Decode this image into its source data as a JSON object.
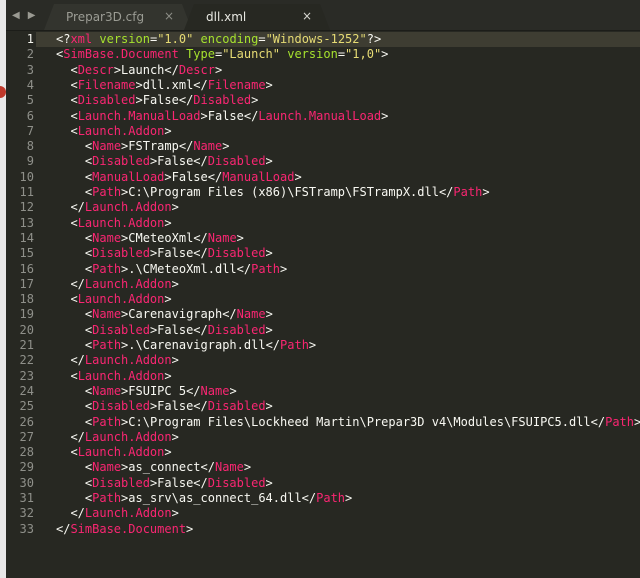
{
  "tabs": [
    {
      "label": "Prepar3D.cfg",
      "active": false,
      "close": "×"
    },
    {
      "label": "dll.xml",
      "active": true,
      "close": "×"
    }
  ],
  "nav": {
    "left": "◀",
    "right": "▶"
  },
  "current_line": 1,
  "colors": {
    "background": "#272822",
    "tag": "#f92672",
    "attribute": "#a6e22e",
    "string": "#e6db74",
    "text": "#f8f8f2",
    "line_number": "#8f908a"
  },
  "lines": [
    {
      "num": "1",
      "tokens": [
        {
          "t": "br",
          "v": "<?"
        },
        {
          "t": "kw",
          "v": "xml"
        },
        {
          "t": "txt",
          "v": " "
        },
        {
          "t": "attr",
          "v": "version"
        },
        {
          "t": "br",
          "v": "="
        },
        {
          "t": "str",
          "v": "\"1.0\""
        },
        {
          "t": "txt",
          "v": " "
        },
        {
          "t": "attr",
          "v": "encoding"
        },
        {
          "t": "br",
          "v": "="
        },
        {
          "t": "str",
          "v": "\"Windows-1252\""
        },
        {
          "t": "br",
          "v": "?>"
        }
      ]
    },
    {
      "num": "2",
      "tokens": [
        {
          "t": "br",
          "v": "<"
        },
        {
          "t": "tag",
          "v": "SimBase.Document"
        },
        {
          "t": "txt",
          "v": " "
        },
        {
          "t": "attr",
          "v": "Type"
        },
        {
          "t": "br",
          "v": "="
        },
        {
          "t": "str",
          "v": "\"Launch\""
        },
        {
          "t": "txt",
          "v": " "
        },
        {
          "t": "attr",
          "v": "version"
        },
        {
          "t": "br",
          "v": "="
        },
        {
          "t": "str",
          "v": "\"1,0\""
        },
        {
          "t": "br",
          "v": ">"
        }
      ]
    },
    {
      "num": "3",
      "tokens": [
        {
          "t": "txt",
          "v": "  "
        },
        {
          "t": "br",
          "v": "<"
        },
        {
          "t": "tag",
          "v": "Descr"
        },
        {
          "t": "br",
          "v": ">"
        },
        {
          "t": "txt",
          "v": "Launch"
        },
        {
          "t": "br",
          "v": "</"
        },
        {
          "t": "tag",
          "v": "Descr"
        },
        {
          "t": "br",
          "v": ">"
        }
      ]
    },
    {
      "num": "4",
      "tokens": [
        {
          "t": "txt",
          "v": "  "
        },
        {
          "t": "br",
          "v": "<"
        },
        {
          "t": "tag",
          "v": "Filename"
        },
        {
          "t": "br",
          "v": ">"
        },
        {
          "t": "txt",
          "v": "dll.xml"
        },
        {
          "t": "br",
          "v": "</"
        },
        {
          "t": "tag",
          "v": "Filename"
        },
        {
          "t": "br",
          "v": ">"
        }
      ]
    },
    {
      "num": "5",
      "tokens": [
        {
          "t": "txt",
          "v": "  "
        },
        {
          "t": "br",
          "v": "<"
        },
        {
          "t": "tag",
          "v": "Disabled"
        },
        {
          "t": "br",
          "v": ">"
        },
        {
          "t": "txt",
          "v": "False"
        },
        {
          "t": "br",
          "v": "</"
        },
        {
          "t": "tag",
          "v": "Disabled"
        },
        {
          "t": "br",
          "v": ">"
        }
      ]
    },
    {
      "num": "6",
      "tokens": [
        {
          "t": "txt",
          "v": "  "
        },
        {
          "t": "br",
          "v": "<"
        },
        {
          "t": "tag",
          "v": "Launch.ManualLoad"
        },
        {
          "t": "br",
          "v": ">"
        },
        {
          "t": "txt",
          "v": "False"
        },
        {
          "t": "br",
          "v": "</"
        },
        {
          "t": "tag",
          "v": "Launch.ManualLoad"
        },
        {
          "t": "br",
          "v": ">"
        }
      ]
    },
    {
      "num": "7",
      "tokens": [
        {
          "t": "txt",
          "v": "  "
        },
        {
          "t": "br",
          "v": "<"
        },
        {
          "t": "tag",
          "v": "Launch.Addon"
        },
        {
          "t": "br",
          "v": ">"
        }
      ]
    },
    {
      "num": "8",
      "tokens": [
        {
          "t": "txt",
          "v": "    "
        },
        {
          "t": "br",
          "v": "<"
        },
        {
          "t": "tag",
          "v": "Name"
        },
        {
          "t": "br",
          "v": ">"
        },
        {
          "t": "txt",
          "v": "FSTramp"
        },
        {
          "t": "br",
          "v": "</"
        },
        {
          "t": "tag",
          "v": "Name"
        },
        {
          "t": "br",
          "v": ">"
        }
      ]
    },
    {
      "num": "9",
      "tokens": [
        {
          "t": "txt",
          "v": "    "
        },
        {
          "t": "br",
          "v": "<"
        },
        {
          "t": "tag",
          "v": "Disabled"
        },
        {
          "t": "br",
          "v": ">"
        },
        {
          "t": "txt",
          "v": "False"
        },
        {
          "t": "br",
          "v": "</"
        },
        {
          "t": "tag",
          "v": "Disabled"
        },
        {
          "t": "br",
          "v": ">"
        }
      ]
    },
    {
      "num": "10",
      "tokens": [
        {
          "t": "txt",
          "v": "    "
        },
        {
          "t": "br",
          "v": "<"
        },
        {
          "t": "tag",
          "v": "ManualLoad"
        },
        {
          "t": "br",
          "v": ">"
        },
        {
          "t": "txt",
          "v": "False"
        },
        {
          "t": "br",
          "v": "</"
        },
        {
          "t": "tag",
          "v": "ManualLoad"
        },
        {
          "t": "br",
          "v": ">"
        }
      ]
    },
    {
      "num": "11",
      "tokens": [
        {
          "t": "txt",
          "v": "    "
        },
        {
          "t": "br",
          "v": "<"
        },
        {
          "t": "tag",
          "v": "Path"
        },
        {
          "t": "br",
          "v": ">"
        },
        {
          "t": "txt",
          "v": "C:\\Program Files (x86)\\FSTramp\\FSTrampX.dll"
        },
        {
          "t": "br",
          "v": "</"
        },
        {
          "t": "tag",
          "v": "Path"
        },
        {
          "t": "br",
          "v": ">"
        }
      ]
    },
    {
      "num": "12",
      "tokens": [
        {
          "t": "txt",
          "v": "  "
        },
        {
          "t": "br",
          "v": "</"
        },
        {
          "t": "tag",
          "v": "Launch.Addon"
        },
        {
          "t": "br",
          "v": ">"
        }
      ]
    },
    {
      "num": "13",
      "tokens": [
        {
          "t": "txt",
          "v": "  "
        },
        {
          "t": "br",
          "v": "<"
        },
        {
          "t": "tag",
          "v": "Launch.Addon"
        },
        {
          "t": "br",
          "v": ">"
        }
      ]
    },
    {
      "num": "14",
      "tokens": [
        {
          "t": "txt",
          "v": "    "
        },
        {
          "t": "br",
          "v": "<"
        },
        {
          "t": "tag",
          "v": "Name"
        },
        {
          "t": "br",
          "v": ">"
        },
        {
          "t": "txt",
          "v": "CMeteoXml"
        },
        {
          "t": "br",
          "v": "</"
        },
        {
          "t": "tag",
          "v": "Name"
        },
        {
          "t": "br",
          "v": ">"
        }
      ]
    },
    {
      "num": "15",
      "tokens": [
        {
          "t": "txt",
          "v": "    "
        },
        {
          "t": "br",
          "v": "<"
        },
        {
          "t": "tag",
          "v": "Disabled"
        },
        {
          "t": "br",
          "v": ">"
        },
        {
          "t": "txt",
          "v": "False"
        },
        {
          "t": "br",
          "v": "</"
        },
        {
          "t": "tag",
          "v": "Disabled"
        },
        {
          "t": "br",
          "v": ">"
        }
      ]
    },
    {
      "num": "16",
      "tokens": [
        {
          "t": "txt",
          "v": "    "
        },
        {
          "t": "br",
          "v": "<"
        },
        {
          "t": "tag",
          "v": "Path"
        },
        {
          "t": "br",
          "v": ">"
        },
        {
          "t": "txt",
          "v": ".\\CMeteoXml.dll"
        },
        {
          "t": "br",
          "v": "</"
        },
        {
          "t": "tag",
          "v": "Path"
        },
        {
          "t": "br",
          "v": ">"
        }
      ]
    },
    {
      "num": "17",
      "tokens": [
        {
          "t": "txt",
          "v": "  "
        },
        {
          "t": "br",
          "v": "</"
        },
        {
          "t": "tag",
          "v": "Launch.Addon"
        },
        {
          "t": "br",
          "v": ">"
        }
      ]
    },
    {
      "num": "18",
      "tokens": [
        {
          "t": "txt",
          "v": "  "
        },
        {
          "t": "br",
          "v": "<"
        },
        {
          "t": "tag",
          "v": "Launch.Addon"
        },
        {
          "t": "br",
          "v": ">"
        }
      ]
    },
    {
      "num": "19",
      "tokens": [
        {
          "t": "txt",
          "v": "    "
        },
        {
          "t": "br",
          "v": "<"
        },
        {
          "t": "tag",
          "v": "Name"
        },
        {
          "t": "br",
          "v": ">"
        },
        {
          "t": "txt",
          "v": "Carenavigraph"
        },
        {
          "t": "br",
          "v": "</"
        },
        {
          "t": "tag",
          "v": "Name"
        },
        {
          "t": "br",
          "v": ">"
        }
      ]
    },
    {
      "num": "20",
      "tokens": [
        {
          "t": "txt",
          "v": "    "
        },
        {
          "t": "br",
          "v": "<"
        },
        {
          "t": "tag",
          "v": "Disabled"
        },
        {
          "t": "br",
          "v": ">"
        },
        {
          "t": "txt",
          "v": "False"
        },
        {
          "t": "br",
          "v": "</"
        },
        {
          "t": "tag",
          "v": "Disabled"
        },
        {
          "t": "br",
          "v": ">"
        }
      ]
    },
    {
      "num": "21",
      "tokens": [
        {
          "t": "txt",
          "v": "    "
        },
        {
          "t": "br",
          "v": "<"
        },
        {
          "t": "tag",
          "v": "Path"
        },
        {
          "t": "br",
          "v": ">"
        },
        {
          "t": "txt",
          "v": ".\\Carenavigraph.dll"
        },
        {
          "t": "br",
          "v": "</"
        },
        {
          "t": "tag",
          "v": "Path"
        },
        {
          "t": "br",
          "v": ">"
        }
      ]
    },
    {
      "num": "22",
      "tokens": [
        {
          "t": "txt",
          "v": "  "
        },
        {
          "t": "br",
          "v": "</"
        },
        {
          "t": "tag",
          "v": "Launch.Addon"
        },
        {
          "t": "br",
          "v": ">"
        }
      ]
    },
    {
      "num": "23",
      "tokens": [
        {
          "t": "txt",
          "v": "  "
        },
        {
          "t": "br",
          "v": "<"
        },
        {
          "t": "tag",
          "v": "Launch.Addon"
        },
        {
          "t": "br",
          "v": ">"
        }
      ]
    },
    {
      "num": "24",
      "tokens": [
        {
          "t": "txt",
          "v": "    "
        },
        {
          "t": "br",
          "v": "<"
        },
        {
          "t": "tag",
          "v": "Name"
        },
        {
          "t": "br",
          "v": ">"
        },
        {
          "t": "txt",
          "v": "FSUIPC 5"
        },
        {
          "t": "br",
          "v": "</"
        },
        {
          "t": "tag",
          "v": "Name"
        },
        {
          "t": "br",
          "v": ">"
        }
      ]
    },
    {
      "num": "25",
      "tokens": [
        {
          "t": "txt",
          "v": "    "
        },
        {
          "t": "br",
          "v": "<"
        },
        {
          "t": "tag",
          "v": "Disabled"
        },
        {
          "t": "br",
          "v": ">"
        },
        {
          "t": "txt",
          "v": "False"
        },
        {
          "t": "br",
          "v": "</"
        },
        {
          "t": "tag",
          "v": "Disabled"
        },
        {
          "t": "br",
          "v": ">"
        }
      ]
    },
    {
      "num": "26",
      "tokens": [
        {
          "t": "txt",
          "v": "    "
        },
        {
          "t": "br",
          "v": "<"
        },
        {
          "t": "tag",
          "v": "Path"
        },
        {
          "t": "br",
          "v": ">"
        },
        {
          "t": "txt",
          "v": "C:\\Program Files\\Lockheed Martin\\Prepar3D v4\\Modules\\FSUIPC5.dll"
        },
        {
          "t": "br",
          "v": "</"
        },
        {
          "t": "tag",
          "v": "Path"
        },
        {
          "t": "br",
          "v": ">"
        }
      ]
    },
    {
      "num": "27",
      "tokens": [
        {
          "t": "txt",
          "v": "  "
        },
        {
          "t": "br",
          "v": "</"
        },
        {
          "t": "tag",
          "v": "Launch.Addon"
        },
        {
          "t": "br",
          "v": ">"
        }
      ]
    },
    {
      "num": "28",
      "tokens": [
        {
          "t": "txt",
          "v": "  "
        },
        {
          "t": "br",
          "v": "<"
        },
        {
          "t": "tag",
          "v": "Launch.Addon"
        },
        {
          "t": "br",
          "v": ">"
        }
      ]
    },
    {
      "num": "29",
      "tokens": [
        {
          "t": "txt",
          "v": "    "
        },
        {
          "t": "br",
          "v": "<"
        },
        {
          "t": "tag",
          "v": "Name"
        },
        {
          "t": "br",
          "v": ">"
        },
        {
          "t": "txt",
          "v": "as_connect"
        },
        {
          "t": "br",
          "v": "</"
        },
        {
          "t": "tag",
          "v": "Name"
        },
        {
          "t": "br",
          "v": ">"
        }
      ]
    },
    {
      "num": "30",
      "tokens": [
        {
          "t": "txt",
          "v": "    "
        },
        {
          "t": "br",
          "v": "<"
        },
        {
          "t": "tag",
          "v": "Disabled"
        },
        {
          "t": "br",
          "v": ">"
        },
        {
          "t": "txt",
          "v": "False"
        },
        {
          "t": "br",
          "v": "</"
        },
        {
          "t": "tag",
          "v": "Disabled"
        },
        {
          "t": "br",
          "v": ">"
        }
      ]
    },
    {
      "num": "31",
      "tokens": [
        {
          "t": "txt",
          "v": "    "
        },
        {
          "t": "br",
          "v": "<"
        },
        {
          "t": "tag",
          "v": "Path"
        },
        {
          "t": "br",
          "v": ">"
        },
        {
          "t": "txt",
          "v": "as_srv\\as_connect_64.dll"
        },
        {
          "t": "br",
          "v": "</"
        },
        {
          "t": "tag",
          "v": "Path"
        },
        {
          "t": "br",
          "v": ">"
        }
      ]
    },
    {
      "num": "32",
      "tokens": [
        {
          "t": "txt",
          "v": "  "
        },
        {
          "t": "br",
          "v": "</"
        },
        {
          "t": "tag",
          "v": "Launch.Addon"
        },
        {
          "t": "br",
          "v": ">"
        }
      ]
    },
    {
      "num": "33",
      "tokens": [
        {
          "t": "br",
          "v": "</"
        },
        {
          "t": "tag",
          "v": "SimBase.Document"
        },
        {
          "t": "br",
          "v": ">"
        }
      ]
    }
  ]
}
